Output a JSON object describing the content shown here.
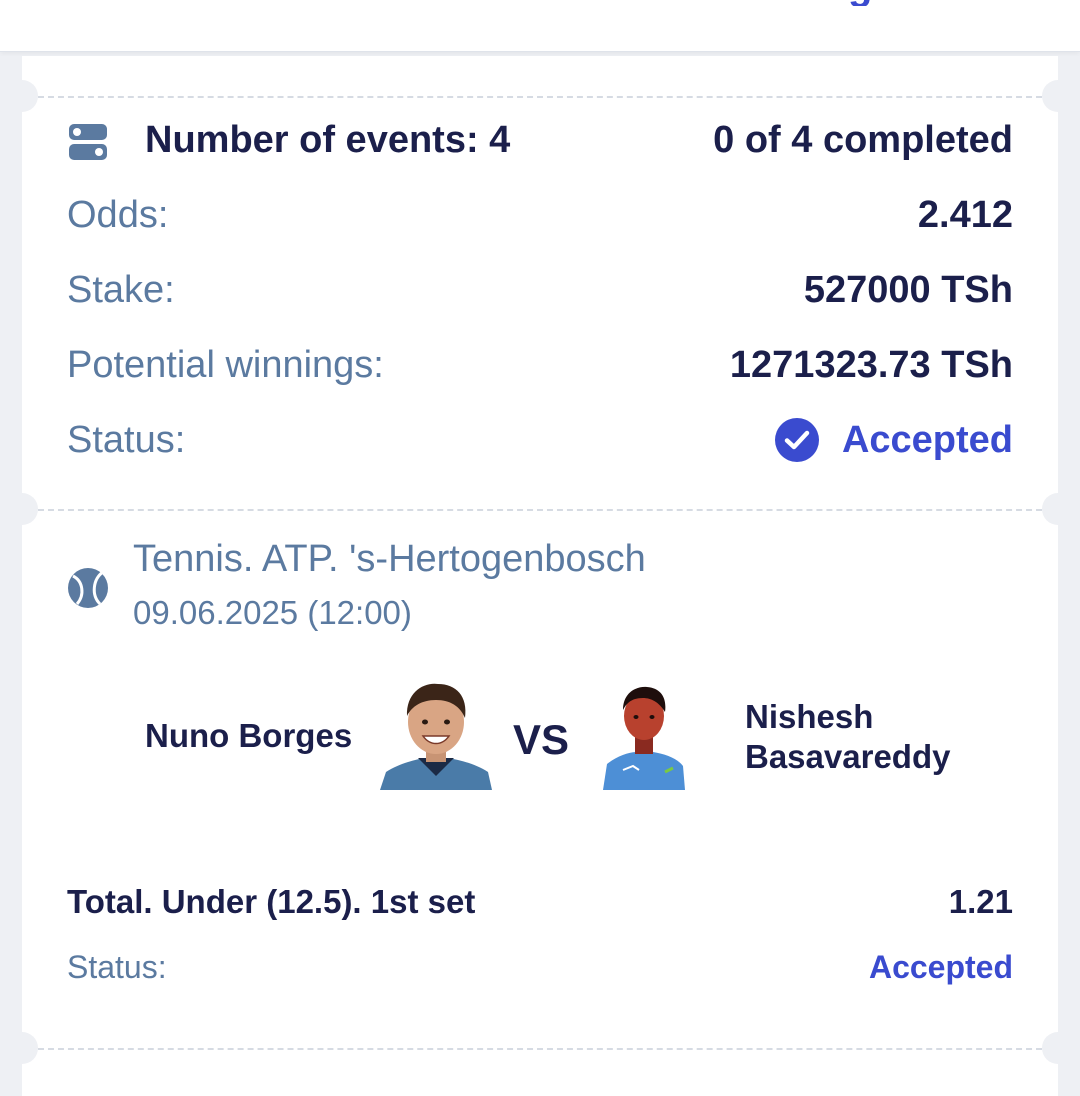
{
  "colors": {
    "primary_text": "#1b1f4b",
    "secondary_text": "#5b7aa0",
    "accent": "#3a4bcf",
    "background": "#eef0f4",
    "card": "#ffffff"
  },
  "header": {
    "cut_text": "g"
  },
  "summary": {
    "events_icon": "events-toggle-icon",
    "events_label": "Number of events: 4",
    "completed_label": "0 of 4 completed",
    "odds_label": "Odds:",
    "odds_value": "2.412",
    "stake_label": "Stake:",
    "stake_value": "527000 TSh",
    "winnings_label": "Potential winnings:",
    "winnings_value": "1271323.73 TSh",
    "status_label": "Status:",
    "status_icon": "check-circle-icon",
    "status_value": "Accepted"
  },
  "event": {
    "sport_icon": "tennis-ball-icon",
    "league": "Tennis. ATP. 's-Hertogenbosch",
    "date": "09.06.2025 (12:00)",
    "home_player": "Nuno Borges",
    "vs_label": "VS",
    "away_player_line1": "Nishesh",
    "away_player_line2": "Basavareddy",
    "market": "Total. Under (12.5). 1st set",
    "market_odds": "1.21",
    "status_label": "Status:",
    "status_value": "Accepted"
  }
}
